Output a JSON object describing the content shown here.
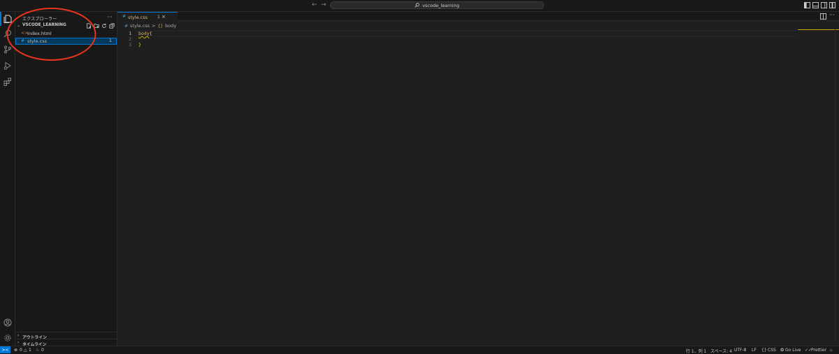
{
  "titlebar": {
    "search_label": "vscode_learning",
    "search_icon": "search-icon",
    "back_icon": "arrow-left-icon",
    "forward_icon": "arrow-right-icon"
  },
  "activitybar": {
    "items": [
      "explorer-icon",
      "search-icon",
      "source-control-icon",
      "run-debug-icon",
      "extensions-icon"
    ],
    "bottom": [
      "account-icon",
      "gear-icon"
    ]
  },
  "sidebar": {
    "title": "エクスプローラー",
    "more": "···",
    "folder": "VSCODE_LEARNING",
    "files": [
      {
        "icon": "<>",
        "name": "index.html",
        "badge": ""
      },
      {
        "icon": "#",
        "name": "style.css",
        "badge": "1"
      }
    ],
    "outline_label": "アウトライン",
    "timeline_label": "タイムライン"
  },
  "tabs": [
    {
      "icon": "#",
      "label": "style.css",
      "badge": "1",
      "close": "×"
    }
  ],
  "breadcrumb": {
    "file_icon": "#",
    "file": "style.css",
    "separator": ">",
    "symbol_icon": "{}",
    "symbol": "body"
  },
  "editor": {
    "lines": [
      {
        "no": "1",
        "selector": "body",
        "brace": "{"
      },
      {
        "no": "2",
        "text": ""
      },
      {
        "no": "3",
        "brace": "}"
      }
    ]
  },
  "statusbar": {
    "remote": "><",
    "errors": "0",
    "warnings": "1",
    "ports": "0",
    "position": "行 1、列 1",
    "spaces": "スペース: 4",
    "encoding": "UTF-8",
    "eol": "LF",
    "language": "CSS",
    "golive": "Go Live",
    "prettier": "Prettier"
  },
  "colors": {
    "accent": "#0078d4",
    "warning": "#cca700",
    "css_icon": "#519aba",
    "selector": "#d7ba7d",
    "annotation": "#e8341c"
  }
}
